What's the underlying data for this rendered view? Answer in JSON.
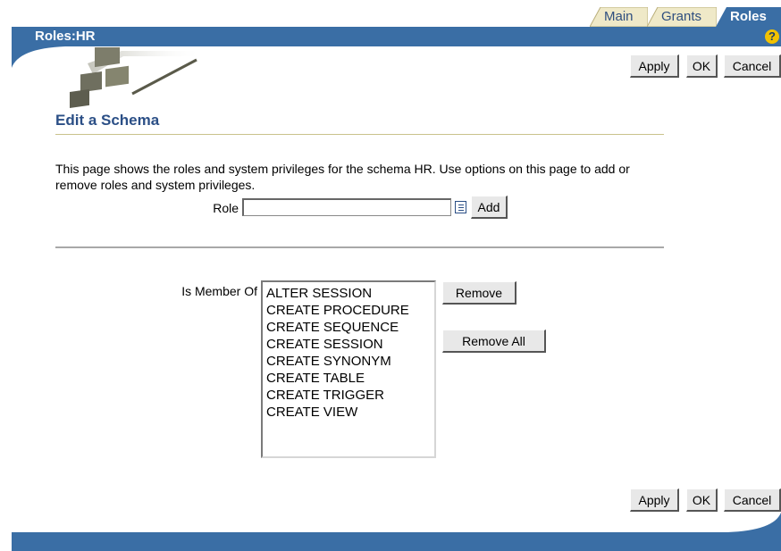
{
  "tabs": [
    "Main",
    "Grants",
    "Roles"
  ],
  "header": {
    "title": "Roles:HR",
    "help": "?"
  },
  "actions": {
    "apply": "Apply",
    "ok": "OK",
    "cancel": "Cancel"
  },
  "page": {
    "heading": "Edit a Schema",
    "description": "This page shows the roles and system privileges for the schema HR. Use options on this page to add or remove roles and system privileges."
  },
  "role_field": {
    "label": "Role",
    "value": "",
    "add_label": "Add"
  },
  "member": {
    "label": "Is Member Of",
    "items": [
      "ALTER SESSION",
      "CREATE PROCEDURE",
      "CREATE SEQUENCE",
      "CREATE SESSION",
      "CREATE SYNONYM",
      "CREATE TABLE",
      "CREATE TRIGGER",
      "CREATE VIEW"
    ],
    "remove_label": "Remove",
    "remove_all_label": "Remove All"
  },
  "colors": {
    "brand": "#3a6ea5",
    "heading": "#2b4f86",
    "tab_inactive": "#efe9c8",
    "help": "#f2c200"
  }
}
